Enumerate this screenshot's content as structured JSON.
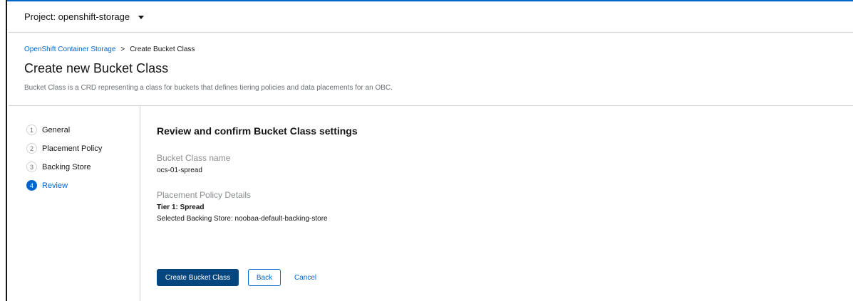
{
  "project": {
    "label": "Project: openshift-storage"
  },
  "breadcrumb": {
    "link": "OpenShift Container Storage",
    "separator": ">",
    "current": "Create Bucket Class"
  },
  "page": {
    "title": "Create new Bucket Class",
    "description": "Bucket Class is a CRD representing a class for buckets that defines tiering policies and data placements for an OBC."
  },
  "wizard": {
    "steps": [
      {
        "num": "1",
        "label": "General"
      },
      {
        "num": "2",
        "label": "Placement Policy"
      },
      {
        "num": "3",
        "label": "Backing Store"
      },
      {
        "num": "4",
        "label": "Review"
      }
    ],
    "active_step": "4"
  },
  "review": {
    "title": "Review and confirm Bucket Class settings",
    "name_label": "Bucket Class name",
    "name_value": "ocs-01-spread",
    "policy_label": "Placement Policy Details",
    "tier_value": "Tier 1: Spread",
    "backing_store_value": "Selected Backing Store: noobaa-default-backing-store"
  },
  "actions": {
    "create": "Create Bucket Class",
    "back": "Back",
    "cancel": "Cancel"
  },
  "colors": {
    "accent": "#0066cc",
    "primary_button": "#06467e",
    "muted_text": "#6a6e73"
  }
}
